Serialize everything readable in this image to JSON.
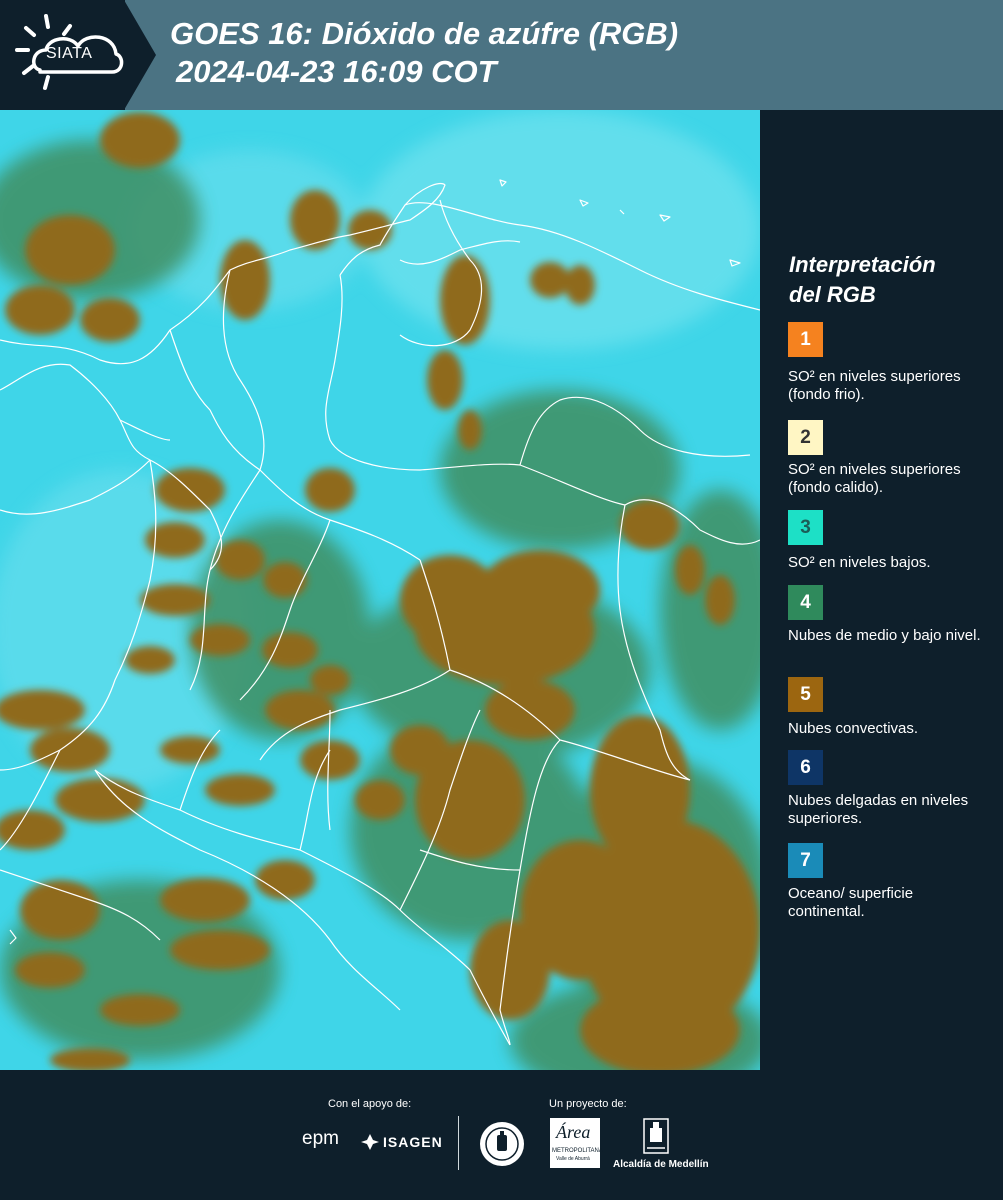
{
  "header": {
    "logo_text": "SIATA",
    "title_line1": "GOES 16: Dióxido de azúfre (RGB)",
    "title_line2": "2024-04-23 16:09 COT"
  },
  "legend": {
    "title_line1": "Interpretación",
    "title_line2": "del RGB",
    "items": [
      {
        "num": "1",
        "color": "#f5821f",
        "text": "SO² en niveles superiores (fondo frio)."
      },
      {
        "num": "2",
        "color": "#fff6c4",
        "text": "SO² en niveles superiores (fondo calido)."
      },
      {
        "num": "3",
        "color": "#1de0c6",
        "text": "SO² en niveles bajos."
      },
      {
        "num": "4",
        "color": "#2f8a5c",
        "text": "Nubes de medio y bajo nivel."
      },
      {
        "num": "5",
        "color": "#9c6610",
        "text": "Nubes convectivas."
      },
      {
        "num": "6",
        "color": "#0e3566",
        "text": "Nubes delgadas en niveles superiores."
      },
      {
        "num": "7",
        "color": "#1a8bb8",
        "text": "Oceano/ superficie continental."
      }
    ]
  },
  "footer": {
    "support_label": "Con el apoyo de:",
    "project_label": "Un proyecto de:",
    "sponsors": [
      "epm",
      "ISAGEN"
    ],
    "partners": [
      "Área Metropolitana Valle de Aburrá",
      "Alcaldía de Medellín"
    ],
    "alcaldia_text": "Alcaldía de Medellín",
    "area_text": "Área",
    "area_sub1": "METROPOLITANA",
    "area_sub2": "Valle de Aburrá"
  },
  "map": {
    "colors": {
      "background": "#3fd5e8",
      "clouds": "#8f6a1f",
      "low_clouds": "#3f8f62",
      "borders": "#ffffff"
    }
  }
}
